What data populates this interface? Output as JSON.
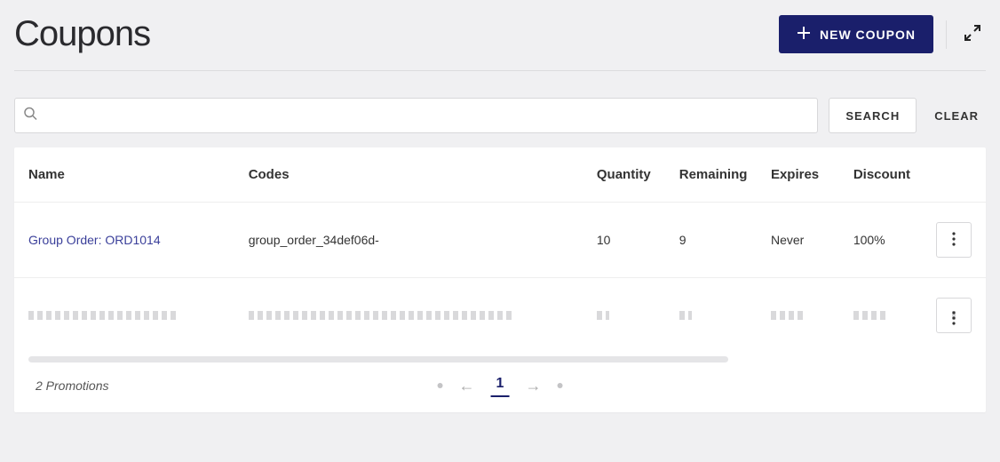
{
  "header": {
    "title": "Coupons",
    "new_button_label": "NEW COUPON"
  },
  "search": {
    "placeholder": "",
    "value": "",
    "search_label": "SEARCH",
    "clear_label": "CLEAR"
  },
  "table": {
    "columns": {
      "name": "Name",
      "codes": "Codes",
      "quantity": "Quantity",
      "remaining": "Remaining",
      "expires": "Expires",
      "discount": "Discount"
    },
    "rows": [
      {
        "name": "Group Order: ORD1014",
        "codes": "group_order_34def06d-",
        "quantity": "10",
        "remaining": "9",
        "expires": "Never",
        "discount": "100%"
      }
    ]
  },
  "footer": {
    "count_label": "2 Promotions",
    "current_page": "1"
  },
  "colors": {
    "primary": "#1a1f6b"
  }
}
